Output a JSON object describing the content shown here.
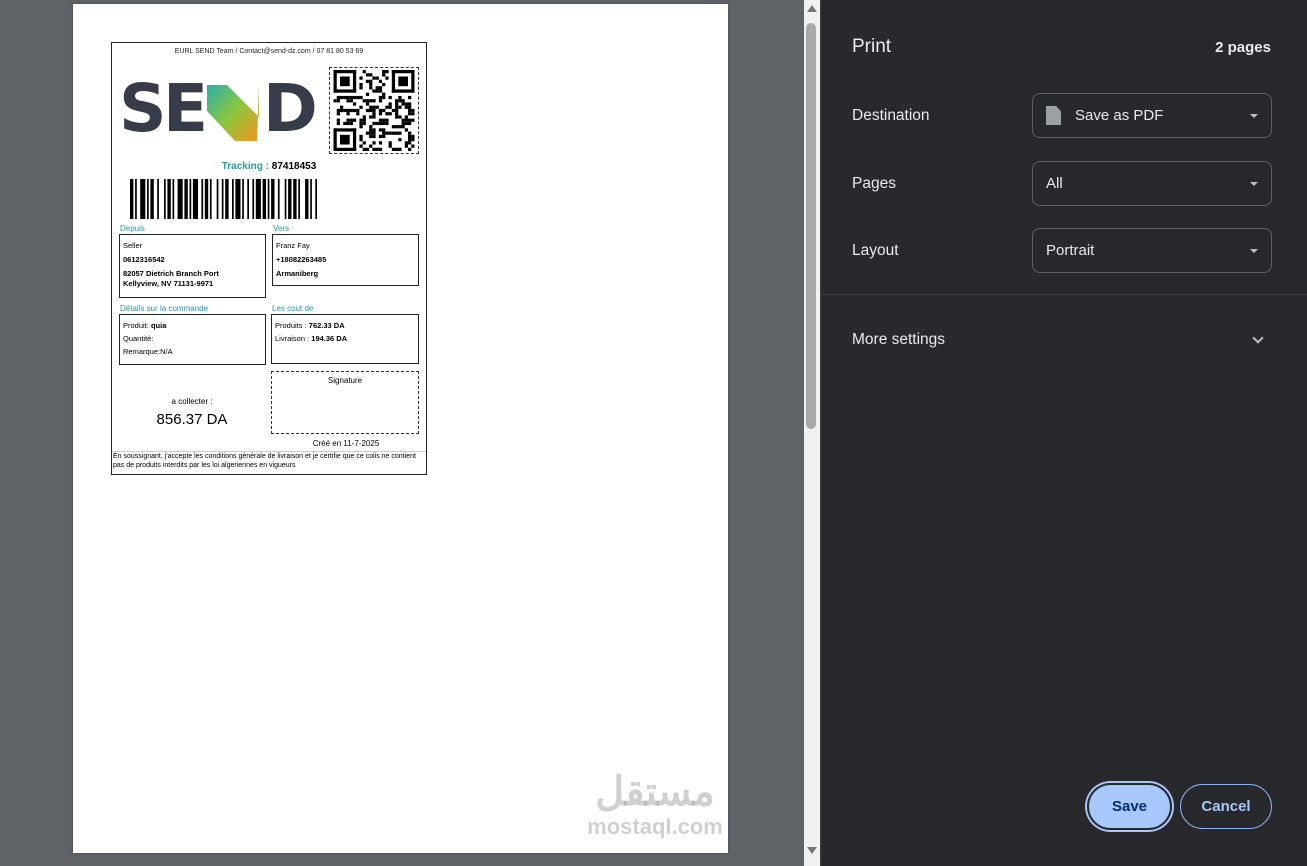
{
  "label": {
    "contact": "EURL SEND Team / Contact@send-dz.com / 07 81 80 53 69",
    "brand": "SEND",
    "tracking_label": "Tracking :",
    "tracking_number": "87418453",
    "from": {
      "title": "Depuis",
      "name": "Seller",
      "phone": "0612316542",
      "address_1": "82057 Dietrich Branch Port",
      "address_2": "Kellyview, NV 71131-9971"
    },
    "to": {
      "title": "Vers",
      "name": "Franz Fay",
      "phone": "+18082263485",
      "city": "Armaniberg"
    },
    "details": {
      "title": "Détails sur la commande",
      "product_label": "Produit:",
      "product_value": "quia",
      "quantity_label": "Quantité:",
      "remark_label": "Remarque:",
      "remark_value": "N/A"
    },
    "costs": {
      "title": "Les cout de",
      "products_label": "Produits :",
      "products_value": "762.33 DA",
      "delivery_label": "Livraison :",
      "delivery_value": "194.36 DA"
    },
    "signature_label": "Signature",
    "collect_label": "a collecter :",
    "collect_amount": "856.37 DA",
    "created": "Créé en 11-7-2025",
    "disclaimer": "En soussignant, j'accepte les conditions générale de livraison et je certifie que ce colis ne contient pas de produits interdits par les loi algeriennes en vigueurs"
  },
  "watermark": {
    "arabic": "مستقل",
    "latin": "mostaql.com"
  },
  "panel": {
    "title": "Print",
    "page_count": "2 pages",
    "destination_label": "Destination",
    "destination_value": "Save as PDF",
    "pages_label": "Pages",
    "pages_value": "All",
    "layout_label": "Layout",
    "layout_value": "Portrait",
    "more_settings": "More settings",
    "save": "Save",
    "cancel": "Cancel"
  },
  "colors": {
    "panel_bg": "#27292d",
    "accent": "#a8c7fa",
    "tracking_teal": "#2a9d9f",
    "section_blue": "#2a8fb4"
  }
}
